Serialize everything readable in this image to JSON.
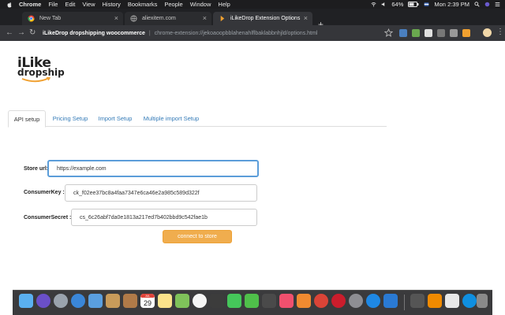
{
  "menubar": {
    "app_name": "Chrome",
    "items": [
      "File",
      "Edit",
      "View",
      "History",
      "Bookmarks",
      "People",
      "Window",
      "Help"
    ],
    "battery": "64%",
    "clock": "Mon 2:39 PM"
  },
  "browser": {
    "tabs": [
      {
        "title": "New Tab",
        "favicon": "chrome-icon",
        "active": false
      },
      {
        "title": "aliexitem.com",
        "favicon": "globe-icon",
        "active": false
      },
      {
        "title": "iLikeDrop Extension Options",
        "favicon": "ilikedrop-icon",
        "active": true
      }
    ],
    "site_name": "iLikeDrop dropshipping woocommerce",
    "url": "chrome-extension://jekoaoopbblahenahlflbaklabbnhjld/options.html"
  },
  "page": {
    "logo": {
      "word1": "iLike",
      "word2": "dropship",
      "accent_color": "#f0a030"
    },
    "tabs": [
      "API setup",
      "Pricing Setup",
      "Import Setup",
      "Multiple import Setup"
    ],
    "active_tab": "API setup",
    "form": {
      "store_url_label": "Store url:",
      "store_url_value": "https://example.com",
      "consumer_key_label": "ConsumerKey :",
      "consumer_key_value": "ck_f02ee37bc8a4faa7347e6ca46e2a985c589d322f",
      "consumer_secret_label": "ConsumerSecret :",
      "consumer_secret_value": "cs_6c26abf7da0e1813a217ed7b402bbd9c542fae1b",
      "connect_label": "connect to store"
    }
  },
  "colors": {
    "link": "#337ab7",
    "button": "#f0ad4e",
    "focus": "#5b9dd9"
  },
  "dock": {
    "calendar_day": "29",
    "calendar_month": "JUL"
  }
}
